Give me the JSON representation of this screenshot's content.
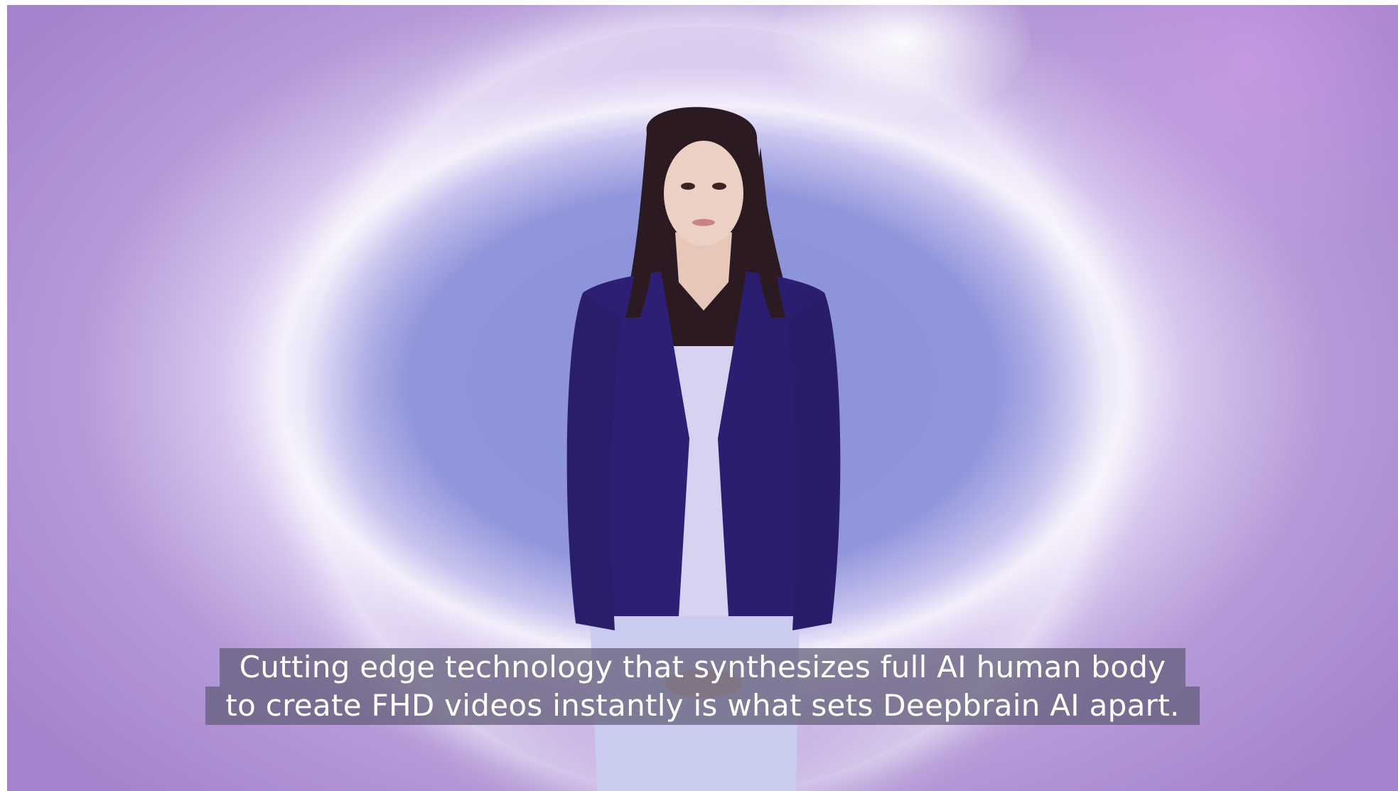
{
  "video": {
    "presenter_name": "",
    "colors": {
      "background": "#a483cc",
      "center": "#8c90d8",
      "jacket": "#2a1f72",
      "caption_bg": "#605c76"
    }
  },
  "subtitle": {
    "line1": "Cutting edge technology that synthesizes full AI human body",
    "line2": "to create FHD videos instantly is what sets Deepbrain AI apart."
  }
}
